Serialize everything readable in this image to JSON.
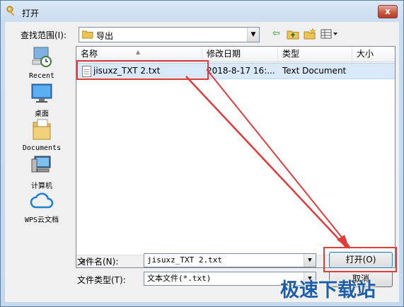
{
  "window": {
    "title": "打开",
    "close_glyph": "x"
  },
  "look_in": {
    "label": "查找范围(I):",
    "value": "导出"
  },
  "toolbar": {
    "back_icon": "back-arrow-icon",
    "up_icon": "up-folder-icon",
    "new_folder_icon": "new-folder-icon",
    "view_icon": "view-menu-icon"
  },
  "places": [
    {
      "label": "Recent",
      "icon": "recent-icon"
    },
    {
      "label": "桌面",
      "icon": "desktop-icon"
    },
    {
      "label": "Documents",
      "icon": "documents-icon"
    },
    {
      "label": "计算机",
      "icon": "computer-icon"
    },
    {
      "label": "WPS云文档",
      "icon": "cloud-icon"
    }
  ],
  "columns": [
    "名称",
    "修改日期",
    "类型",
    "大小"
  ],
  "files": [
    {
      "name": "jisuxz_TXT 2.txt",
      "modified": "2018-8-17 16:...",
      "type": "Text Document",
      "size": ""
    }
  ],
  "file_name": {
    "label": "文件名(N):",
    "value": "jisuxz_TXT 2.txt"
  },
  "file_type": {
    "label": "文件类型(T):",
    "value": "文本文件(*.txt)"
  },
  "buttons": {
    "open": "打开(O)",
    "cancel": "取消"
  },
  "watermark": "极速下载站",
  "colors": {
    "annotation": "#e03c3c",
    "selection": "#d9e8fb",
    "watermark": "#1e5ea8"
  }
}
